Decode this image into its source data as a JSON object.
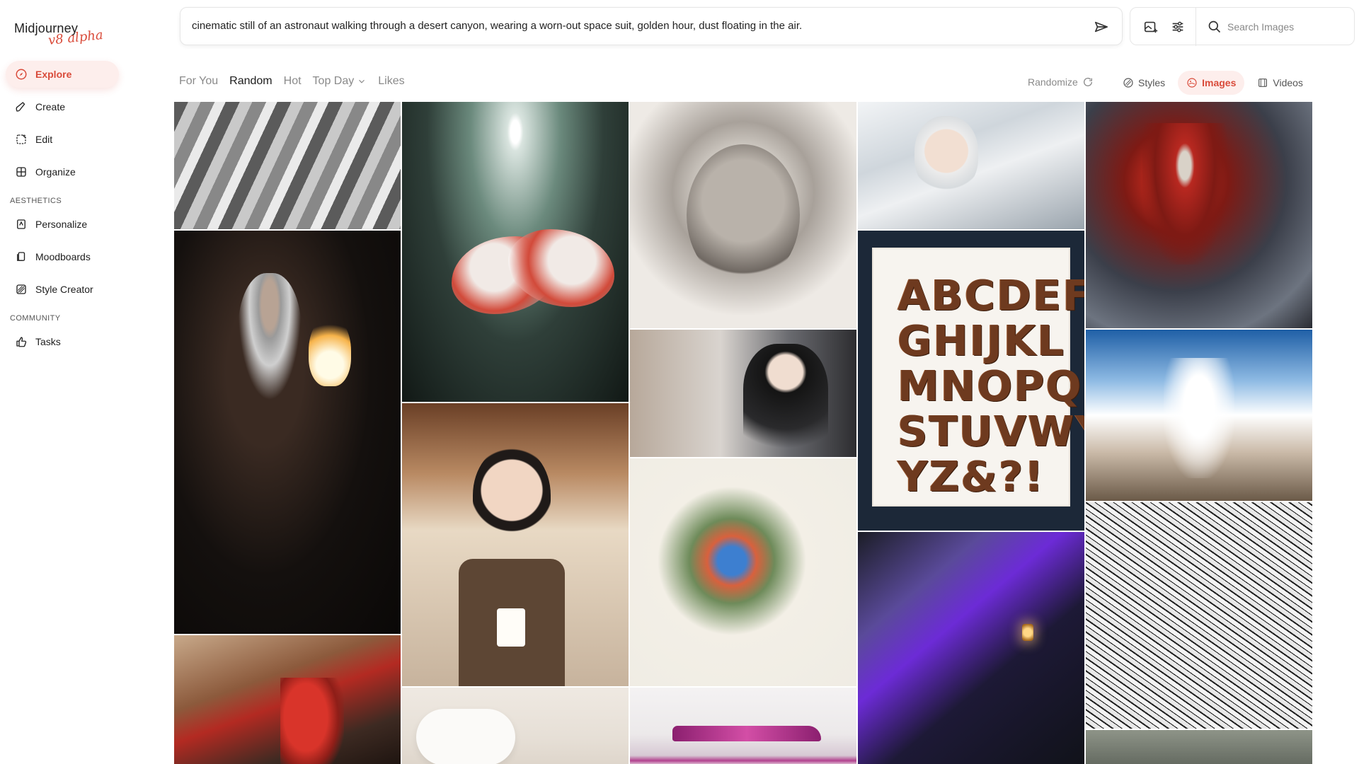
{
  "app": {
    "logo_main": "Midjourney",
    "logo_sub": "v8 alpha",
    "accent_color": "#d94b3a"
  },
  "sidebar": {
    "items": [
      {
        "label": "Explore",
        "icon": "compass-icon",
        "active": true
      },
      {
        "label": "Create",
        "icon": "brush-icon",
        "active": false
      },
      {
        "label": "Edit",
        "icon": "edit-frame-icon",
        "active": false
      },
      {
        "label": "Organize",
        "icon": "grid-icon",
        "active": false
      }
    ],
    "section_aesthetics": "AESTHETICS",
    "aesthetics_items": [
      {
        "label": "Personalize",
        "icon": "personalize-icon"
      },
      {
        "label": "Moodboards",
        "icon": "moodboard-icon"
      },
      {
        "label": "Style Creator",
        "icon": "style-creator-icon"
      }
    ],
    "section_community": "COMMUNITY",
    "community_items": [
      {
        "label": "Tasks",
        "icon": "thumbs-up-icon"
      }
    ]
  },
  "prompt": {
    "text": "cinematic still of an astronaut walking through a desert canyon, wearing a worn-out space suit, golden hour, dust floating in the air."
  },
  "search": {
    "placeholder": "Search Images"
  },
  "filters": {
    "tabs": [
      {
        "label": "For You",
        "active": false
      },
      {
        "label": "Random",
        "active": true
      },
      {
        "label": "Hot",
        "active": false
      },
      {
        "label": "Top Day",
        "active": false,
        "dropdown": true
      },
      {
        "label": "Likes",
        "active": false
      }
    ],
    "randomize_label": "Randomize"
  },
  "view_tabs": [
    {
      "label": "Styles",
      "icon": "palette-icon",
      "active": false
    },
    {
      "label": "Images",
      "icon": "image-icon",
      "active": true
    },
    {
      "label": "Videos",
      "icon": "film-icon",
      "active": false
    }
  ],
  "gallery": {
    "letters_art_text": "ABCDEF\nGHIJKL\nMNOPQR\nSTUVWY\nYZ&?!"
  }
}
